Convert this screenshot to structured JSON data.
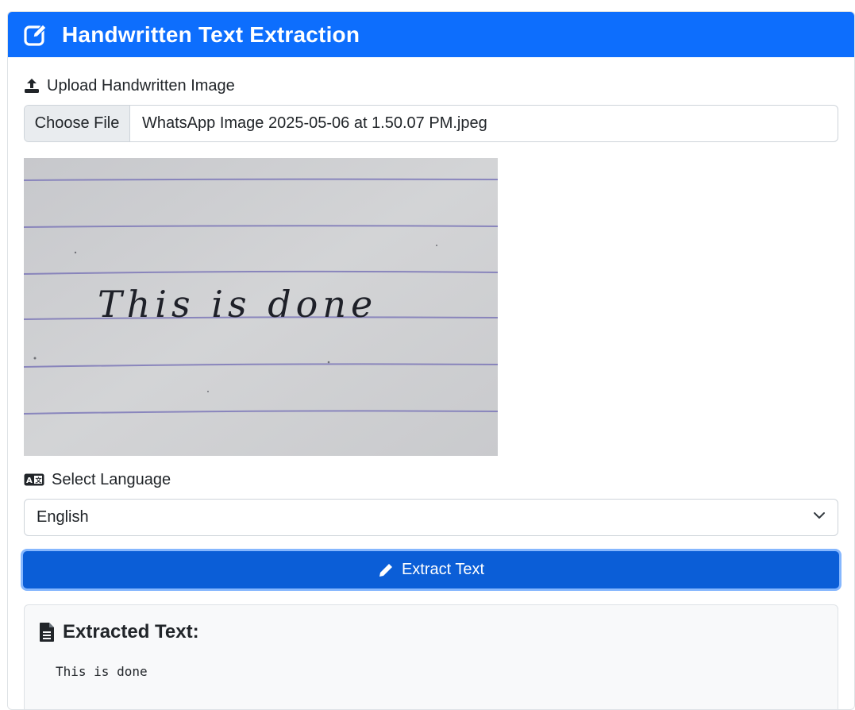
{
  "header": {
    "title": "Handwritten Text Extraction",
    "icon": "pen-to-square-icon",
    "color": "#0d6efd"
  },
  "upload": {
    "label": "Upload Handwritten Image",
    "icon": "upload-icon",
    "button_label": "Choose File",
    "file_name": "WhatsApp Image 2025-05-06 at 1.50.07 PM.jpeg"
  },
  "preview": {
    "handwritten_text": "This is done"
  },
  "language": {
    "label": "Select Language",
    "icon": "language-icon",
    "selected": "English"
  },
  "extract_button": {
    "label": "Extract Text",
    "icon": "pencil-icon",
    "color": "#0b5ed7"
  },
  "result": {
    "heading": "Extracted Text:",
    "icon": "file-lines-icon",
    "text": "This is done"
  }
}
